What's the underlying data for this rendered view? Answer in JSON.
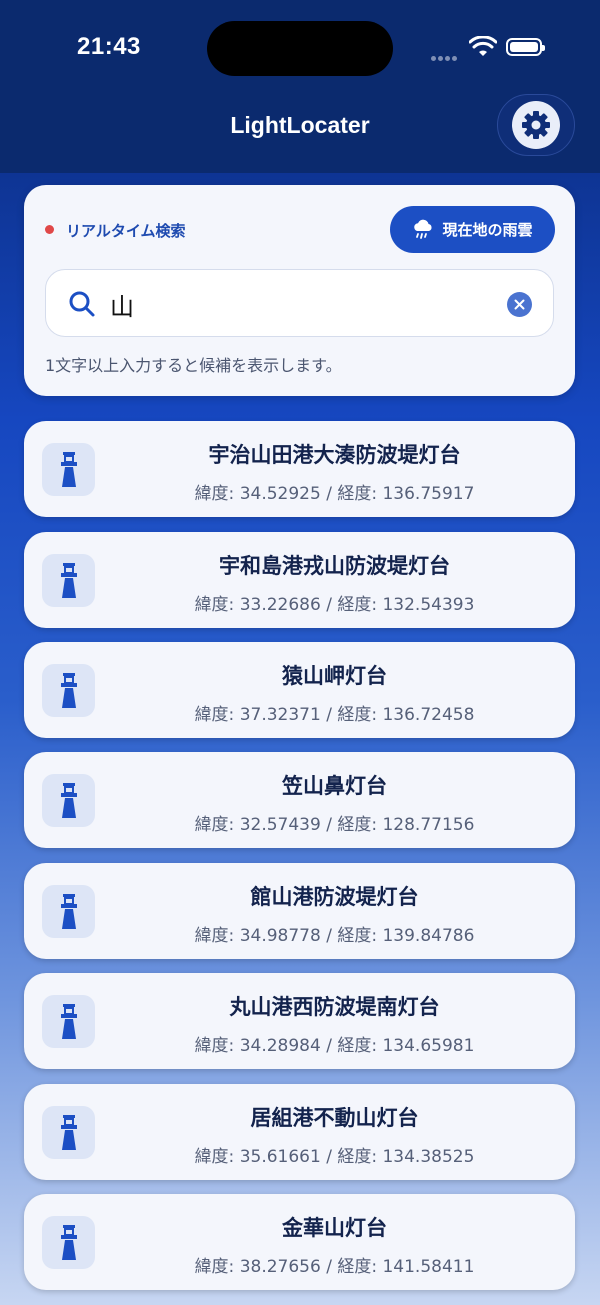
{
  "status_bar": {
    "time": "21:43"
  },
  "nav": {
    "title": "LightLocater",
    "settings_icon": "gear-icon"
  },
  "search": {
    "live_label": "リアルタイム検索",
    "live_dot_color": "#e04848",
    "rain_button_label": "現在地の雨雲",
    "query": "山",
    "hint": "1文字以上入力すると候補を表示します。"
  },
  "results": [
    {
      "name": "宇治山田港大湊防波堤灯台",
      "coords": "緯度: 34.52925 / 経度: 136.75917"
    },
    {
      "name": "宇和島港戎山防波堤灯台",
      "coords": "緯度: 33.22686 / 経度: 132.54393"
    },
    {
      "name": "猿山岬灯台",
      "coords": "緯度: 37.32371 / 経度: 136.72458"
    },
    {
      "name": "笠山鼻灯台",
      "coords": "緯度: 32.57439 / 経度: 128.77156"
    },
    {
      "name": "館山港防波堤灯台",
      "coords": "緯度: 34.98778 / 経度: 139.84786"
    },
    {
      "name": "丸山港西防波堤南灯台",
      "coords": "緯度: 34.28984 / 経度: 134.65981"
    },
    {
      "name": "居組港不動山灯台",
      "coords": "緯度: 35.61661 / 経度: 134.38525"
    },
    {
      "name": "金華山灯台",
      "coords": "緯度: 38.27656 / 経度: 141.58411"
    }
  ],
  "colors": {
    "accent": "#1c4fc4",
    "nav_bg": "#0b2a6e",
    "card_bg": "#f4f6fc"
  }
}
